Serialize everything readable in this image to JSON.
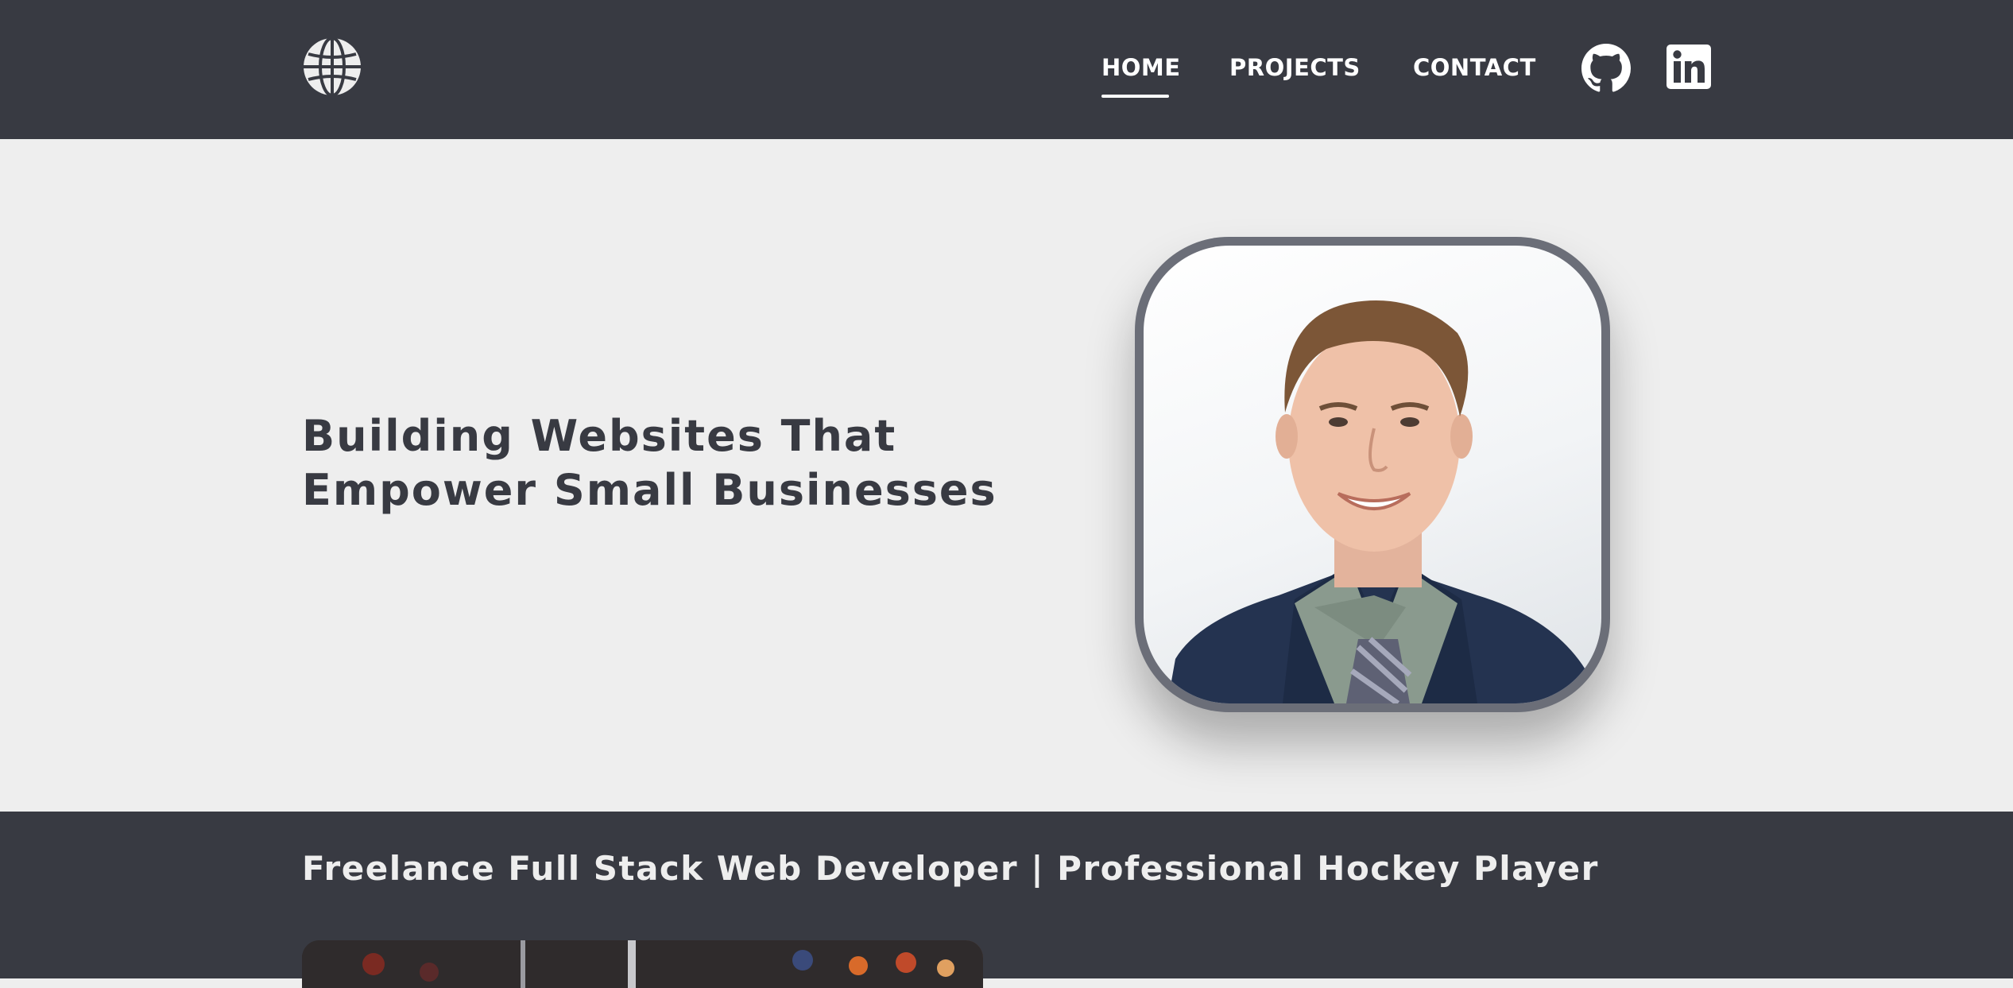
{
  "header": {
    "logo_icon": "globe-icon",
    "nav": {
      "home": "HOME",
      "projects": "PROJECTS",
      "contact": "CONTACT"
    },
    "active_nav": "HOME",
    "social": [
      "github-icon",
      "linkedin-icon"
    ]
  },
  "hero": {
    "title_line1": "Building Websites That",
    "title_line2": "Empower Small Businesses",
    "photo": "portrait-photo"
  },
  "band": {
    "tagline": "Freelance Full Stack Web Developer | Professional Hockey Player"
  },
  "colors": {
    "dark": "#383a42",
    "light": "#eeeeee",
    "frame": "#6b6e78"
  }
}
